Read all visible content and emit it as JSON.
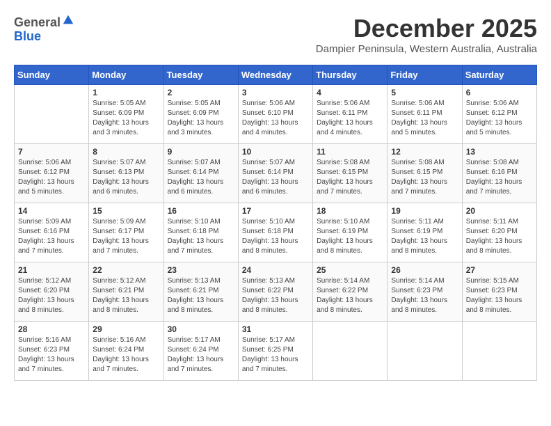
{
  "logo": {
    "general": "General",
    "blue": "Blue"
  },
  "title": "December 2025",
  "subtitle": "Dampier Peninsula, Western Australia, Australia",
  "days_of_week": [
    "Sunday",
    "Monday",
    "Tuesday",
    "Wednesday",
    "Thursday",
    "Friday",
    "Saturday"
  ],
  "weeks": [
    [
      {
        "day": "",
        "info": ""
      },
      {
        "day": "1",
        "info": "Sunrise: 5:05 AM\nSunset: 6:09 PM\nDaylight: 13 hours\nand 3 minutes."
      },
      {
        "day": "2",
        "info": "Sunrise: 5:05 AM\nSunset: 6:09 PM\nDaylight: 13 hours\nand 3 minutes."
      },
      {
        "day": "3",
        "info": "Sunrise: 5:06 AM\nSunset: 6:10 PM\nDaylight: 13 hours\nand 4 minutes."
      },
      {
        "day": "4",
        "info": "Sunrise: 5:06 AM\nSunset: 6:11 PM\nDaylight: 13 hours\nand 4 minutes."
      },
      {
        "day": "5",
        "info": "Sunrise: 5:06 AM\nSunset: 6:11 PM\nDaylight: 13 hours\nand 5 minutes."
      },
      {
        "day": "6",
        "info": "Sunrise: 5:06 AM\nSunset: 6:12 PM\nDaylight: 13 hours\nand 5 minutes."
      }
    ],
    [
      {
        "day": "7",
        "info": "Sunrise: 5:06 AM\nSunset: 6:12 PM\nDaylight: 13 hours\nand 5 minutes."
      },
      {
        "day": "8",
        "info": "Sunrise: 5:07 AM\nSunset: 6:13 PM\nDaylight: 13 hours\nand 6 minutes."
      },
      {
        "day": "9",
        "info": "Sunrise: 5:07 AM\nSunset: 6:14 PM\nDaylight: 13 hours\nand 6 minutes."
      },
      {
        "day": "10",
        "info": "Sunrise: 5:07 AM\nSunset: 6:14 PM\nDaylight: 13 hours\nand 6 minutes."
      },
      {
        "day": "11",
        "info": "Sunrise: 5:08 AM\nSunset: 6:15 PM\nDaylight: 13 hours\nand 7 minutes."
      },
      {
        "day": "12",
        "info": "Sunrise: 5:08 AM\nSunset: 6:15 PM\nDaylight: 13 hours\nand 7 minutes."
      },
      {
        "day": "13",
        "info": "Sunrise: 5:08 AM\nSunset: 6:16 PM\nDaylight: 13 hours\nand 7 minutes."
      }
    ],
    [
      {
        "day": "14",
        "info": "Sunrise: 5:09 AM\nSunset: 6:16 PM\nDaylight: 13 hours\nand 7 minutes."
      },
      {
        "day": "15",
        "info": "Sunrise: 5:09 AM\nSunset: 6:17 PM\nDaylight: 13 hours\nand 7 minutes."
      },
      {
        "day": "16",
        "info": "Sunrise: 5:10 AM\nSunset: 6:18 PM\nDaylight: 13 hours\nand 7 minutes."
      },
      {
        "day": "17",
        "info": "Sunrise: 5:10 AM\nSunset: 6:18 PM\nDaylight: 13 hours\nand 8 minutes."
      },
      {
        "day": "18",
        "info": "Sunrise: 5:10 AM\nSunset: 6:19 PM\nDaylight: 13 hours\nand 8 minutes."
      },
      {
        "day": "19",
        "info": "Sunrise: 5:11 AM\nSunset: 6:19 PM\nDaylight: 13 hours\nand 8 minutes."
      },
      {
        "day": "20",
        "info": "Sunrise: 5:11 AM\nSunset: 6:20 PM\nDaylight: 13 hours\nand 8 minutes."
      }
    ],
    [
      {
        "day": "21",
        "info": "Sunrise: 5:12 AM\nSunset: 6:20 PM\nDaylight: 13 hours\nand 8 minutes."
      },
      {
        "day": "22",
        "info": "Sunrise: 5:12 AM\nSunset: 6:21 PM\nDaylight: 13 hours\nand 8 minutes."
      },
      {
        "day": "23",
        "info": "Sunrise: 5:13 AM\nSunset: 6:21 PM\nDaylight: 13 hours\nand 8 minutes."
      },
      {
        "day": "24",
        "info": "Sunrise: 5:13 AM\nSunset: 6:22 PM\nDaylight: 13 hours\nand 8 minutes."
      },
      {
        "day": "25",
        "info": "Sunrise: 5:14 AM\nSunset: 6:22 PM\nDaylight: 13 hours\nand 8 minutes."
      },
      {
        "day": "26",
        "info": "Sunrise: 5:14 AM\nSunset: 6:23 PM\nDaylight: 13 hours\nand 8 minutes."
      },
      {
        "day": "27",
        "info": "Sunrise: 5:15 AM\nSunset: 6:23 PM\nDaylight: 13 hours\nand 8 minutes."
      }
    ],
    [
      {
        "day": "28",
        "info": "Sunrise: 5:16 AM\nSunset: 6:23 PM\nDaylight: 13 hours\nand 7 minutes."
      },
      {
        "day": "29",
        "info": "Sunrise: 5:16 AM\nSunset: 6:24 PM\nDaylight: 13 hours\nand 7 minutes."
      },
      {
        "day": "30",
        "info": "Sunrise: 5:17 AM\nSunset: 6:24 PM\nDaylight: 13 hours\nand 7 minutes."
      },
      {
        "day": "31",
        "info": "Sunrise: 5:17 AM\nSunset: 6:25 PM\nDaylight: 13 hours\nand 7 minutes."
      },
      {
        "day": "",
        "info": ""
      },
      {
        "day": "",
        "info": ""
      },
      {
        "day": "",
        "info": ""
      }
    ]
  ]
}
